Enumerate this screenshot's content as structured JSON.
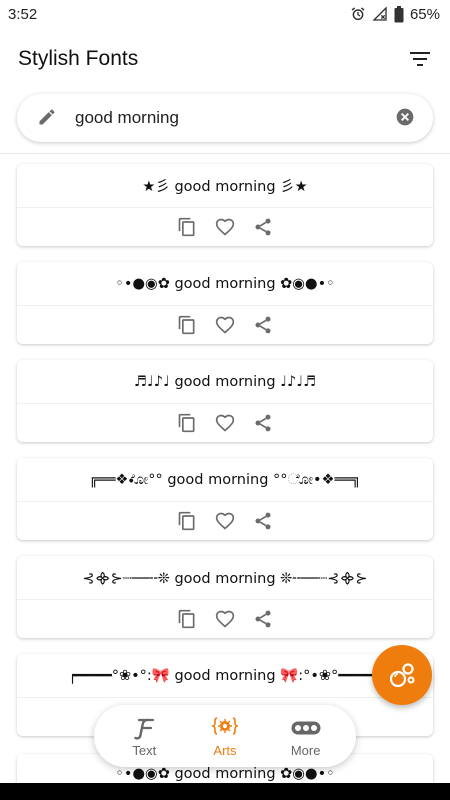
{
  "status_bar": {
    "time": "3:52",
    "battery": "65%"
  },
  "app_bar": {
    "title": "Stylish Fonts"
  },
  "search": {
    "value": "good morning"
  },
  "cards": [
    {
      "text": "★彡 good morning 彡★"
    },
    {
      "text": "◦•●◉✿ good morning ✿◉●•◦"
    },
    {
      "text": "♬♩♪♩ good morning ♩♪♩♬"
    },
    {
      "text": "╔══❖•ೋ°° good morning °°ೋ•❖══╗"
    },
    {
      "text": "⊰᯽⊱┈──╌❊ good morning ❊╌──┈⊰᯽⊱"
    },
    {
      "text": "┍━━━━°❀•°:🎀 good morning 🎀:°•❀°━━━━┙"
    }
  ],
  "last_card": {
    "text": "◦•●◉✿ good morning ✿◉●•◦"
  },
  "bottom_nav": {
    "items": [
      {
        "label": "Text",
        "icon": "script-f-icon"
      },
      {
        "label": "Arts",
        "icon": "arts-icon"
      },
      {
        "label": "More",
        "icon": "more-dots-icon"
      }
    ],
    "active": "Arts"
  },
  "colors": {
    "accent": "#ef7d0d",
    "icon_gray": "#6b6b6b"
  },
  "icons": {
    "search_leading": "pencil-icon",
    "search_trailing": "clear-icon",
    "app_bar_action": "filter-icon",
    "card_actions": [
      "copy-icon",
      "heart-icon",
      "share-icon"
    ],
    "fab": "bubbles-icon"
  }
}
